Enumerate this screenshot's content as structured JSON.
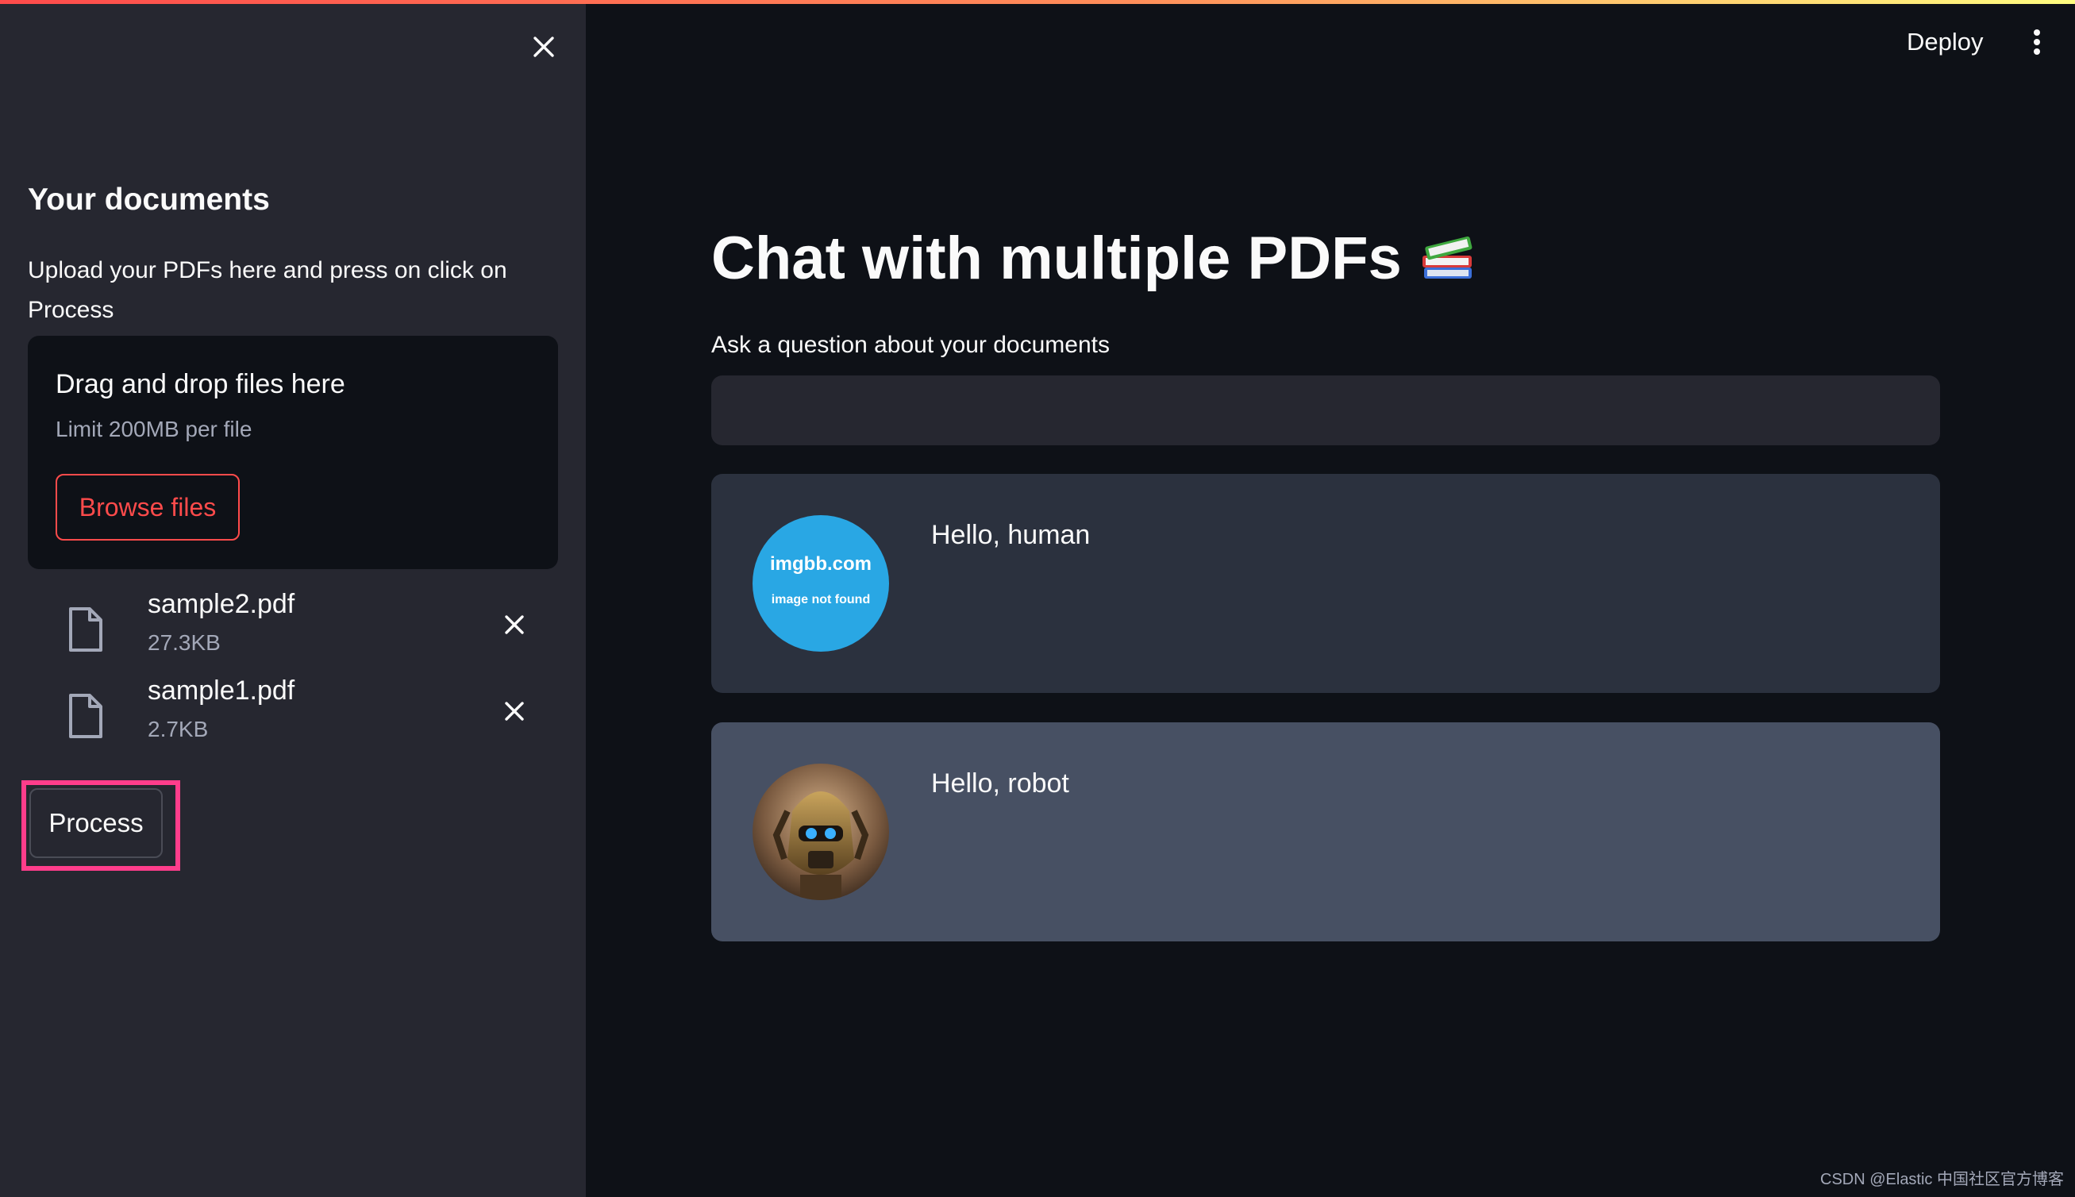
{
  "header": {
    "deploy_label": "Deploy",
    "menu_icon": "vertical-dots-icon",
    "accent_gradient": [
      "#ff4b4b",
      "#fffd80"
    ]
  },
  "sidebar": {
    "close_icon": "close-icon",
    "title": "Your documents",
    "description": "Upload your PDFs here and press on click on Process",
    "uploader": {
      "title": "Drag and drop files here",
      "limit": "Limit 200MB per file",
      "browse_label": "Browse files"
    },
    "files": [
      {
        "name": "sample2.pdf",
        "size": "27.3KB",
        "icon": "file-icon"
      },
      {
        "name": "sample1.pdf",
        "size": "2.7KB",
        "icon": "file-icon"
      }
    ],
    "process_label": "Process"
  },
  "main": {
    "title": "Chat with multiple PDFs",
    "title_icon": "books-icon",
    "question_label": "Ask a question about your documents",
    "question_value": "",
    "messages": [
      {
        "role": "user",
        "avatar_site": "imgbb.com",
        "avatar_note": "image not found",
        "text": "Hello, human"
      },
      {
        "role": "bot",
        "avatar": "robot-avatar",
        "text": "Hello, robot"
      }
    ]
  },
  "watermark": "CSDN @Elastic 中国社区官方博客",
  "colors": {
    "background": "#0e1117",
    "sidebar": "#262730",
    "accent": "#ff4b4b",
    "highlight": "#ff3d8b",
    "user_message_bg": "#2b313e",
    "bot_message_bg": "#475063"
  }
}
